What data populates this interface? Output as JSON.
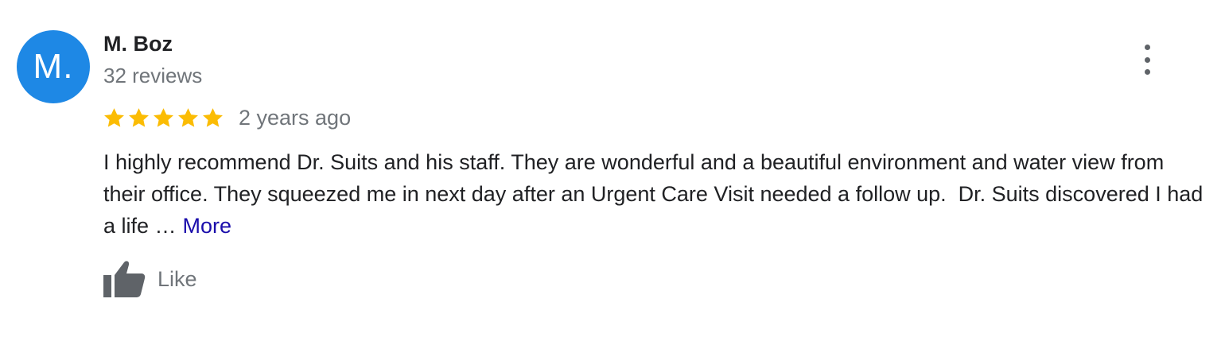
{
  "review": {
    "avatar": {
      "initials": "M.",
      "color": "#1e88e5"
    },
    "author_name": "M. Boz",
    "review_count": "32 reviews",
    "rating": 5,
    "rating_max": 5,
    "star_color": "#fbbc04",
    "time_ago": "2 years ago",
    "text": "I highly recommend Dr. Suits and his staff. They are wonderful and a beautiful environment and water view from their office. They squeezed me in next day after an Urgent Care Visit needed a follow up.  Dr. Suits discovered I had a life …",
    "more_label": "More",
    "more_color": "#1a0dab",
    "like_label": "Like",
    "icons": {
      "menu": "more-vert-icon",
      "like": "thumbs-up-icon",
      "star": "star-icon"
    }
  }
}
